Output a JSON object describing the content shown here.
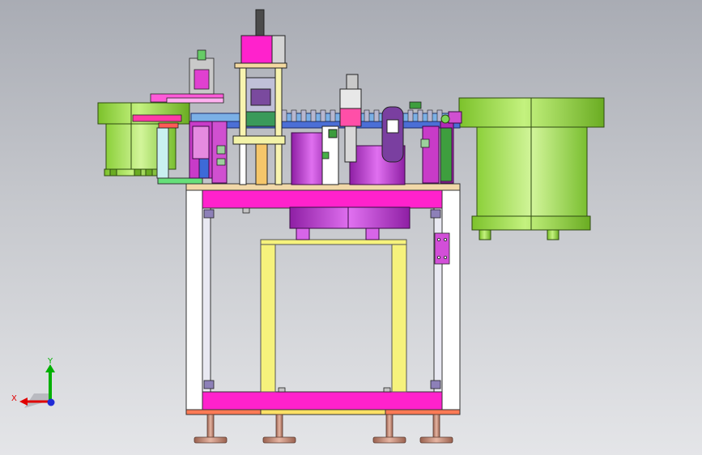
{
  "viewport": {
    "background_top": "#a9acb4",
    "background_bottom": "#e4e5e8"
  },
  "triad": {
    "x_label": "X",
    "y_label": "Y",
    "x_color": "#e00000",
    "y_color": "#00b000",
    "z_color": "#1f2bd6"
  },
  "palette": {
    "frame": "#ffffff",
    "frame_edge": "#444444",
    "beam": "#ff22cc",
    "yellow": "#f4f07a",
    "green_hopper": "#8fd23a",
    "green_hopper_light": "#bff27a",
    "blue_track": "#4b6fd6",
    "purple": "#b833c8",
    "feet": "#c98a72"
  }
}
